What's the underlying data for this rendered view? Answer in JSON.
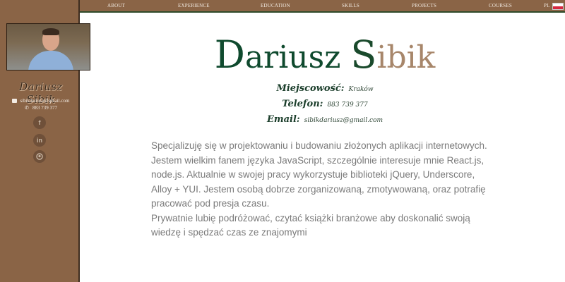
{
  "nav": {
    "items": [
      "ABOUT",
      "EXPERIENCE",
      "EDUCATION",
      "SKILLS",
      "PROJECTS",
      "COURSES"
    ],
    "lang": "PL"
  },
  "sidebar": {
    "signature": "Dariusz Sibik",
    "email": "sibikdariusz@gmail.com",
    "phone": "883 739 377",
    "social_icons": [
      "facebook-icon",
      "linkedin-icon",
      "github-icon"
    ]
  },
  "profile": {
    "name_first_initial": "D",
    "name_first_rest": "ariusz ",
    "name_last_initial": "S",
    "name_last_rest": "ibik",
    "city_label": "Miejscowość:",
    "city_value": "Kraków",
    "phone_label": "Telefon:",
    "phone_value": "883 739 377",
    "email_label": "Email:",
    "email_value": "sibikdariusz@gmail.com"
  },
  "bio": {
    "paragraph1": "Specjalizuję się w projektowaniu i budowaniu złożonych aplikacji internetowych. Jestem wielkim fanem języka JavaScript, szczególnie interesuje mnie React.js, node.js. Aktualnie w swojej pracy wykorzystuje biblioteki jQuery, Underscore, Alloy + YUI. Jestem osobą dobrze zorganizowaną, zmotywowaną, oraz potrafię pracować pod presja czasu.",
    "paragraph2": "Prywatnie lubię podróżować, czytać książki branżowe aby doskonalić swoją wiedzę i spędzać czas ze znajomymi"
  },
  "colors": {
    "sidebar_bg": "#8a6446",
    "name_green": "#0f4a2e",
    "name_tan": "#a7866a",
    "bio_text": "#7a7a7a"
  }
}
